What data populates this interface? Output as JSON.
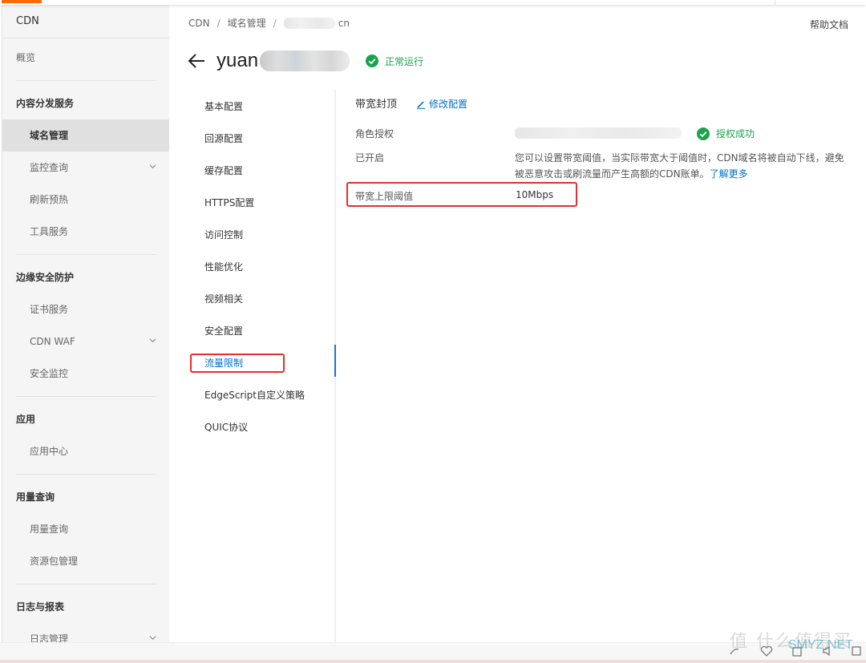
{
  "sidebar": {
    "title": "CDN",
    "overview": "概览",
    "groups": [
      {
        "label": "内容分发服务",
        "items": [
          {
            "label": "域名管理",
            "active": true
          },
          {
            "label": "监控查询",
            "expandable": true
          },
          {
            "label": "刷新预热"
          },
          {
            "label": "工具服务"
          }
        ]
      },
      {
        "label": "边缘安全防护",
        "items": [
          {
            "label": "证书服务"
          },
          {
            "label": "CDN WAF",
            "expandable": true
          },
          {
            "label": "安全监控"
          }
        ]
      },
      {
        "label": "应用",
        "items": [
          {
            "label": "应用中心"
          }
        ]
      },
      {
        "label": "用量查询",
        "items": [
          {
            "label": "用量查询"
          },
          {
            "label": "资源包管理"
          }
        ]
      },
      {
        "label": "日志与报表",
        "items": [
          {
            "label": "日志管理",
            "expandable": true
          }
        ]
      }
    ]
  },
  "header": {
    "breadcrumb": [
      "CDN",
      "域名管理",
      "cn"
    ],
    "help_label": "帮助文档",
    "title_prefix": "yuan",
    "status_label": "正常运行"
  },
  "tabs": [
    {
      "label": "基本配置"
    },
    {
      "label": "回源配置"
    },
    {
      "label": "缓存配置"
    },
    {
      "label": "HTTPS配置"
    },
    {
      "label": "访问控制"
    },
    {
      "label": "性能优化"
    },
    {
      "label": "视频相关"
    },
    {
      "label": "安全配置"
    },
    {
      "label": "流量限制",
      "active": true
    },
    {
      "label": "EdgeScript自定义策略"
    },
    {
      "label": "QUIC协议"
    }
  ],
  "content": {
    "section_title": "带宽封顶",
    "edit_label": "修改配置",
    "role_label": "角色授权",
    "auth_status": "授权成功",
    "enabled_label": "已开启",
    "description": "您可以设置带宽阈值，当实际带宽大于阈值时，CDN域名将被自动下线，避免被恶意攻击或刷流量而产生高额的CDN账单。",
    "learn_more": "了解更多",
    "threshold_label": "带宽上限阈值",
    "threshold_value": "10Mbps"
  },
  "watermark": {
    "text": "值 什么值得买",
    "site": "SMYZ.NET"
  },
  "colors": {
    "accent": "#ff6a00",
    "link": "#0070cc",
    "success": "#1aa34a",
    "highlight_box": "#e62e2e"
  }
}
